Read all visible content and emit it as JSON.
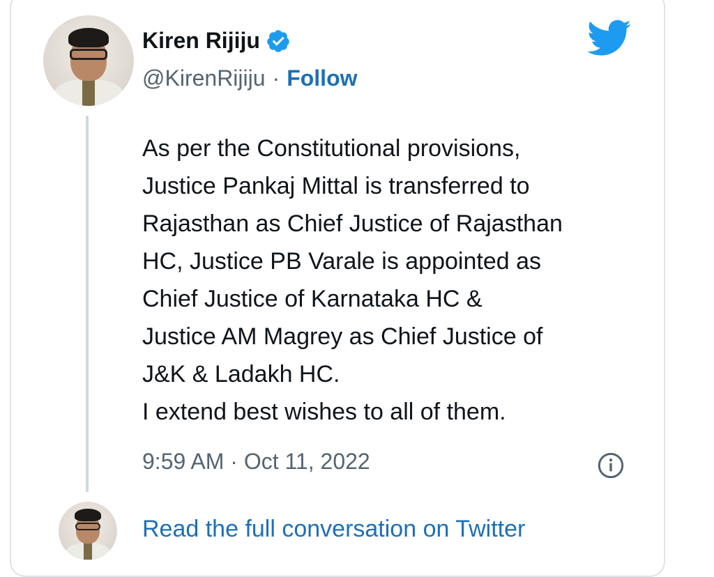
{
  "tweet": {
    "author_name": "Kiren Rijiju",
    "handle": "@KirenRijiju",
    "separator": "·",
    "follow_label": "Follow",
    "text_lines": [
      "As per the Constitutional provisions,",
      "Justice Pankaj Mittal is transferred to",
      "Rajasthan as Chief Justice of Rajasthan",
      "HC, Justice PB Varale is appointed as",
      "Chief Justice of Karnataka HC &",
      "Justice AM Magrey as Chief Justice of",
      "J&K & Ladakh HC.",
      "I extend best wishes to all of them."
    ],
    "timestamp": "9:59 AM · Oct 11, 2022"
  },
  "footer": {
    "read_full_label": "Read the full conversation on Twitter"
  },
  "icons": {
    "verified": "verified-badge-icon",
    "logo": "twitter-bird-icon",
    "info": "info-icon"
  },
  "colors": {
    "link": "#1d6fb8",
    "brand": "#1d9bf0",
    "text": "#0f1419",
    "muted": "#536471",
    "border": "#dfe4e8"
  }
}
